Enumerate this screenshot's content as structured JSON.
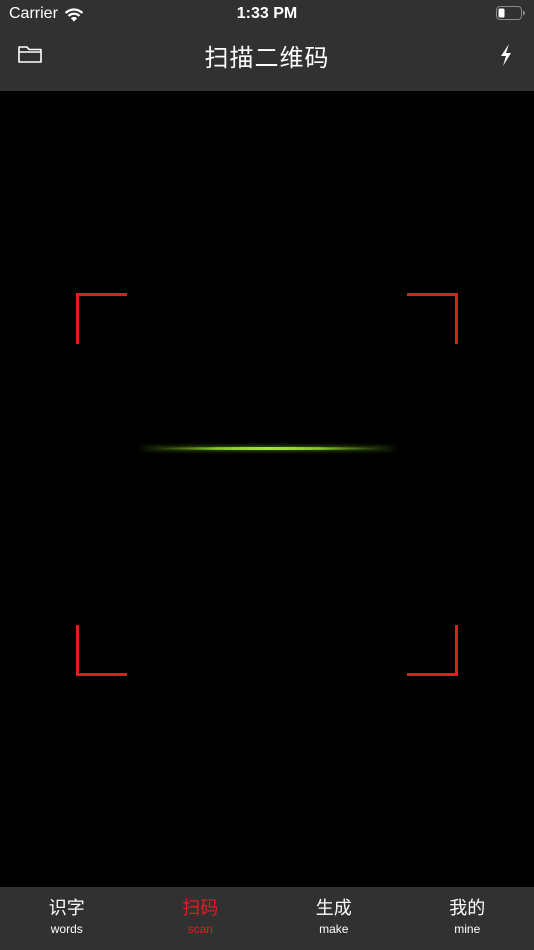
{
  "status_bar": {
    "carrier": "Carrier",
    "time": "1:33 PM"
  },
  "nav": {
    "title": "扫描二维码",
    "left_icon": "folder-icon",
    "right_icon": "flash-icon"
  },
  "scanner": {
    "frame_color": "#e01e1e",
    "scan_line_color": "#a8e040"
  },
  "tabs": [
    {
      "cn": "识字",
      "en": "words",
      "active": false
    },
    {
      "cn": "扫码",
      "en": "scan",
      "active": true
    },
    {
      "cn": "生成",
      "en": "make",
      "active": false
    },
    {
      "cn": "我的",
      "en": "mine",
      "active": false
    }
  ],
  "colors": {
    "bar_background": "#313131",
    "active_tab": "#e01e1e",
    "inactive_tab": "#ffffff"
  }
}
